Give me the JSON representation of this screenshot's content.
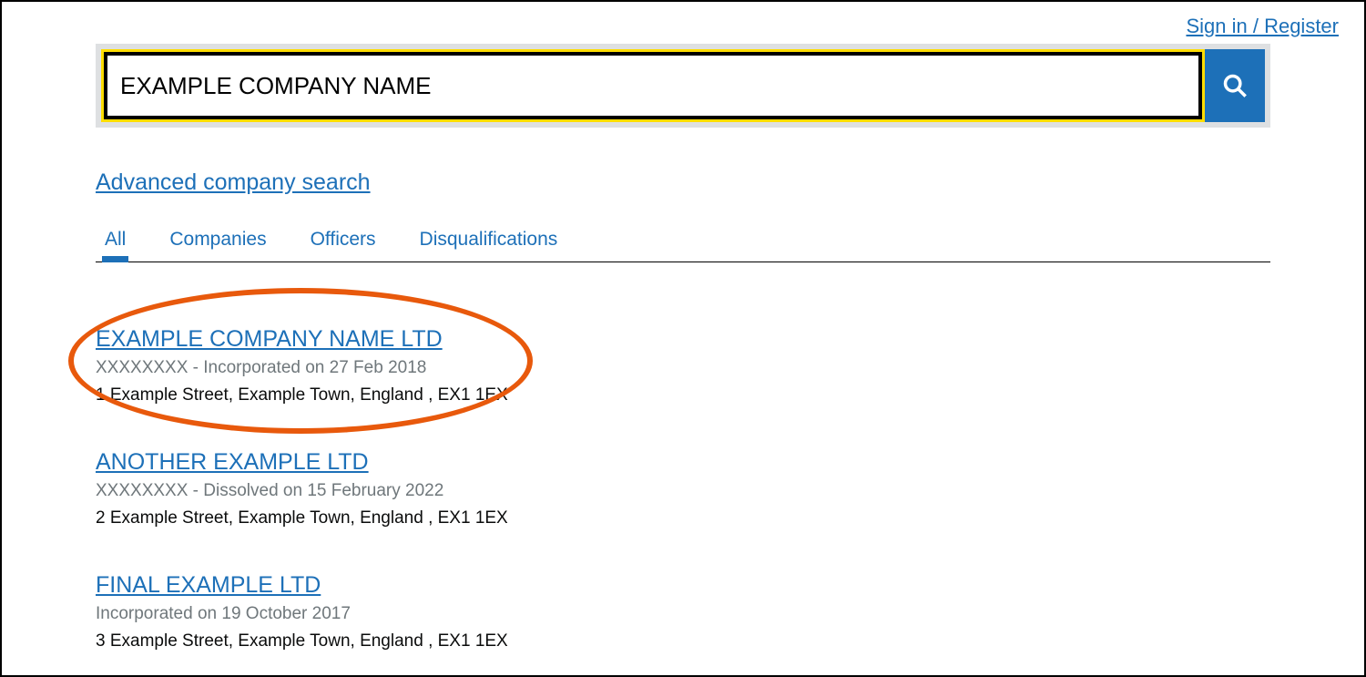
{
  "header": {
    "sign_in_label": "Sign in / Register"
  },
  "search": {
    "value": "EXAMPLE COMPANY NAME",
    "advanced_label": "Advanced company search"
  },
  "tabs": [
    {
      "label": "All",
      "active": true
    },
    {
      "label": "Companies",
      "active": false
    },
    {
      "label": "Officers",
      "active": false
    },
    {
      "label": "Disqualifications",
      "active": false
    }
  ],
  "results": [
    {
      "title": "EXAMPLE COMPANY NAME LTD",
      "meta": "XXXXXXXX - Incorporated on 27 Feb 2018",
      "address": "1 Example Street, Example Town, England , EX1 1EX",
      "highlighted": true
    },
    {
      "title": "ANOTHER EXAMPLE LTD",
      "meta": "XXXXXXXX - Dissolved on 15 February 2022",
      "address": "2 Example Street, Example Town, England , EX1 1EX",
      "highlighted": false
    },
    {
      "title": "FINAL EXAMPLE LTD",
      "meta": "Incorporated on 19 October 2017",
      "address": "3 Example Street, Example Town, England , EX1 1EX",
      "highlighted": false
    }
  ]
}
